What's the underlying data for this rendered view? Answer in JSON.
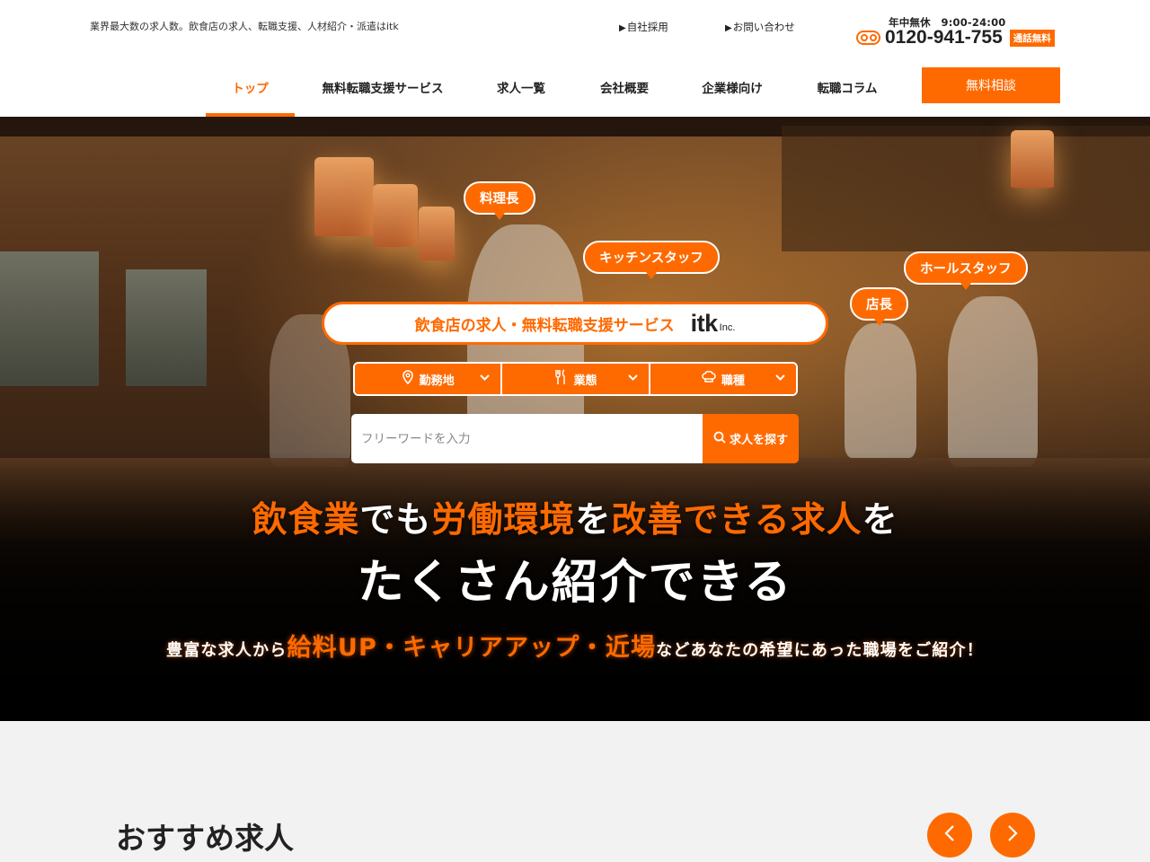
{
  "header": {
    "tagline": "業界最大数の求人数。飲食店の求人、転職支援、人材紹介・派遣はitk",
    "top_links": [
      {
        "label": "自社採用",
        "marker": "▶"
      },
      {
        "label": "お問い合わせ",
        "marker": "▶"
      }
    ],
    "phone": {
      "hours": "年中無休　9:00-24:00",
      "number": "0120-941-755",
      "badge": "通話無料",
      "icon": "freedial-icon"
    },
    "nav": [
      {
        "label": "トップ",
        "active": true
      },
      {
        "label": "無料転職支援サービス",
        "active": false
      },
      {
        "label": "求人一覧",
        "active": false
      },
      {
        "label": "会社概要",
        "active": false
      },
      {
        "label": "企業様向け",
        "active": false
      },
      {
        "label": "転職コラム",
        "active": false
      }
    ],
    "cta_label": "無料相談"
  },
  "hero": {
    "job_bubbles": [
      "料理長",
      "キッチンスタッフ",
      "ホールスタッフ",
      "店長"
    ],
    "service_text": "飲食店の求人・無料転職支援サービス",
    "logo": {
      "name": "itk",
      "suffix": "Inc."
    },
    "dropdowns": [
      {
        "label": "勤務地",
        "icon": "map-pin-icon"
      },
      {
        "label": "業態",
        "icon": "cutlery-icon"
      },
      {
        "label": "職種",
        "icon": "chef-hat-icon"
      }
    ],
    "search": {
      "placeholder": "フリーワードを入力",
      "button_label": "求人を探す",
      "icon": "search-icon"
    },
    "headline1": {
      "p1": "飲食業",
      "p2": "でも",
      "p3": "労働環境",
      "p4": "を",
      "p5": "改善できる求人",
      "p6": "を"
    },
    "headline2": "たくさん紹介できる",
    "subline": {
      "p1": "豊富な求人から",
      "p2": "給料UP・キャリアアップ・近場",
      "p3": "などあなたの希望にあった職場をご紹介！"
    }
  },
  "recommend": {
    "title": "おすすめ求人",
    "prev_icon": "chevron-left-icon",
    "next_icon": "chevron-right-icon"
  },
  "colors": {
    "accent": "#ff6a00",
    "text": "#222222",
    "section_bg": "#f2f2f2"
  }
}
